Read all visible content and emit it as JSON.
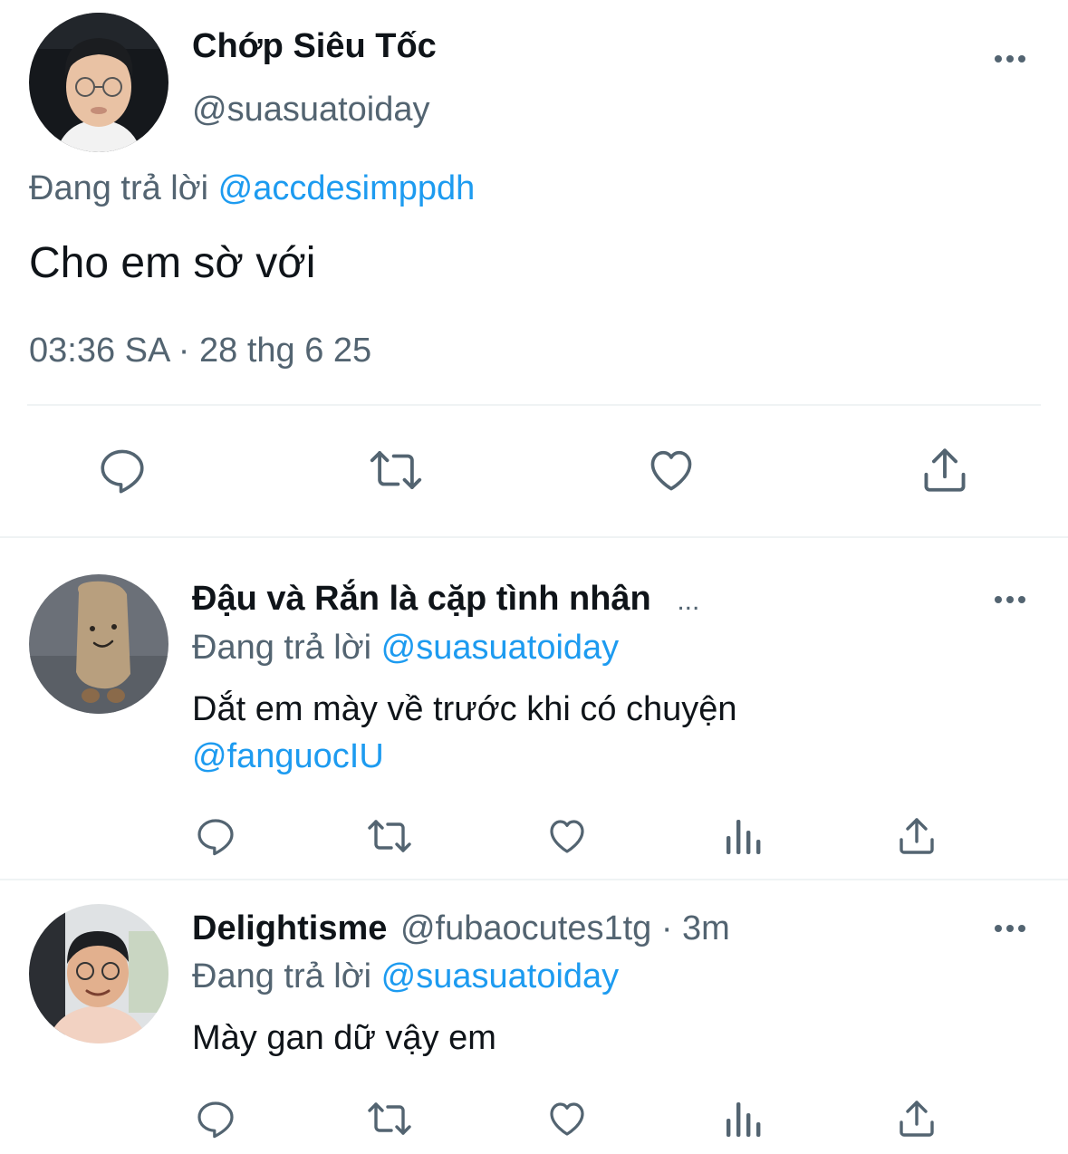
{
  "main_tweet": {
    "display_name": "Chớp Siêu Tốc",
    "handle": "@suasuatoiday",
    "reply_prefix": "Đang trả lời",
    "reply_to": "@accdesimppdh",
    "text": "Cho em sờ với",
    "timestamp": "03:36 SA · 28 thg 6 25"
  },
  "replies": [
    {
      "display_name": "Đậu và Rắn là cặp tình nhân",
      "name_ellipsis": "...",
      "reply_prefix": "Đang trả lời",
      "reply_to": "@suasuatoiday",
      "text": "Dắt em mày về trước khi có chuyện",
      "mention": "@fanguocIU"
    },
    {
      "display_name": "Delightisme",
      "handle_time": "@fubaocutes1tg · 3m",
      "reply_prefix": "Đang trả lời",
      "reply_to": "@suasuatoiday",
      "text": "Mày gan dữ vậy em"
    }
  ],
  "icons": {
    "main_actions": [
      "reply-icon",
      "retweet-icon",
      "like-icon",
      "share-icon"
    ],
    "reply_actions": [
      "reply-icon",
      "retweet-icon",
      "like-icon",
      "analytics-icon",
      "share-icon"
    ]
  },
  "colors": {
    "link": "#1d9bf0",
    "muted": "#536471",
    "text": "#0f1419",
    "divider": "#eff3f4"
  }
}
